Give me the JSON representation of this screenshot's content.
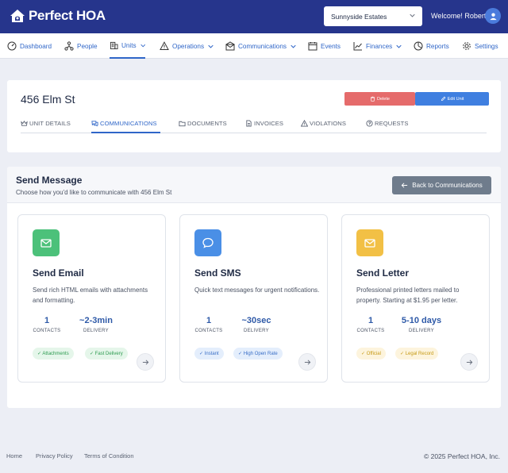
{
  "brand": {
    "name": "Perfect HOA"
  },
  "header": {
    "community_selected": "Sunnyside Estates",
    "welcome": "Welcome! Robert"
  },
  "nav": {
    "items": [
      {
        "label": "Dashboard",
        "icon": "gauge-icon"
      },
      {
        "label": "People",
        "icon": "people-network-icon"
      },
      {
        "label": "Units",
        "icon": "building-icon",
        "active": true,
        "dropdown": true
      },
      {
        "label": "Operations",
        "icon": "warning-icon",
        "dropdown": true
      },
      {
        "label": "Communications",
        "icon": "mail-icon",
        "dropdown": true
      },
      {
        "label": "Events",
        "icon": "calendar-icon"
      },
      {
        "label": "Finances",
        "icon": "chart-line-icon",
        "dropdown": true
      },
      {
        "label": "Reports",
        "icon": "pie-chart-icon"
      },
      {
        "label": "Settings",
        "icon": "gear-icon"
      }
    ]
  },
  "unit": {
    "title": "456 Elm St",
    "delete_label": "Delete",
    "edit_label": "Edit Unit",
    "tabs": [
      {
        "label": "UNIT DETAILS",
        "icon": "crown-icon"
      },
      {
        "label": "COMMUNICATIONS",
        "icon": "chat-icon",
        "active": true
      },
      {
        "label": "DOCUMENTS",
        "icon": "folder-icon"
      },
      {
        "label": "INVOICES",
        "icon": "file-icon"
      },
      {
        "label": "VIOLATIONS",
        "icon": "warning-icon"
      },
      {
        "label": "REQUESTS",
        "icon": "question-icon"
      }
    ]
  },
  "send": {
    "title": "Send Message",
    "subtitle": "Choose how you'd like to communicate with 456 Elm St",
    "back_label": "Back to Communications",
    "options": [
      {
        "title": "Send Email",
        "description": "Send rich HTML emails with attachments and formatting.",
        "contacts_value": "1",
        "contacts_label": "CONTACTS",
        "delivery_value": "~2-3min",
        "delivery_label": "DELIVERY",
        "tags": [
          "✓ Attachments",
          "✓ Fast Delivery"
        ],
        "color": "#4cc17a",
        "icon": "envelope-icon"
      },
      {
        "title": "Send SMS",
        "description": "Quick text messages for urgent notifications.",
        "contacts_value": "1",
        "contacts_label": "CONTACTS",
        "delivery_value": "~30sec",
        "delivery_label": "DELIVERY",
        "tags": [
          "✓ Instant",
          "✓ High Open Rate"
        ],
        "color": "#4a8fe6",
        "icon": "speech-bubble-icon"
      },
      {
        "title": "Send Letter",
        "description": "Professional printed letters mailed to property. Starting at $1.95 per letter.",
        "contacts_value": "1",
        "contacts_label": "CONTACTS",
        "delivery_value": "5-10 days",
        "delivery_label": "DELIVERY",
        "tags": [
          "✓ Official",
          "✓ Legal Record"
        ],
        "color": "#f2c045",
        "icon": "envelope-icon"
      }
    ]
  },
  "footer": {
    "links": [
      "Home",
      "Privacy Policy",
      "Terms of Condition"
    ],
    "copyright": "© 2025 Perfect HOA, Inc."
  },
  "colors": {
    "topbar": "#26358c",
    "accent": "#2f66c8",
    "delete": "#e56b6b",
    "edit": "#3f7fe0",
    "back": "#6f7c8c"
  }
}
